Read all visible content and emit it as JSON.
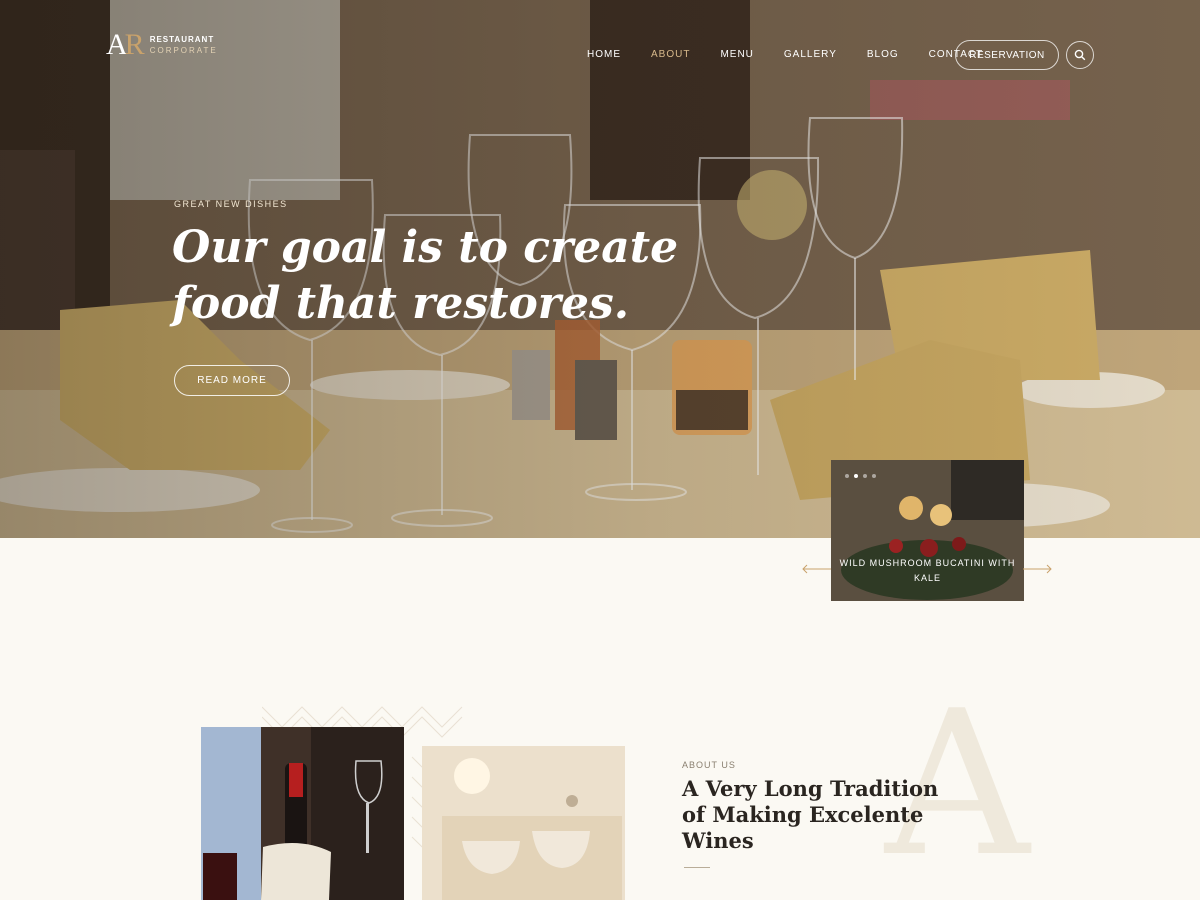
{
  "brand": {
    "mark_a": "A",
    "mark_r": "R",
    "line1": "RESTAURANT",
    "line2": "CORPORATE"
  },
  "nav": {
    "items": [
      {
        "label": "HOME"
      },
      {
        "label": "ABOUT",
        "active": true
      },
      {
        "label": "MENU"
      },
      {
        "label": "GALLERY"
      },
      {
        "label": "BLOG"
      },
      {
        "label": "CONTACT"
      }
    ],
    "reservation_label": "RESERVATION",
    "search_icon": "search-icon"
  },
  "hero": {
    "kicker": "GREAT NEW DISHES",
    "headline": "Our goal is to create food that restores.",
    "cta_label": "READ MORE"
  },
  "slider": {
    "dish_name": "WILD MUSHROOM BUCATINI WITH KALE",
    "dot_count": 4,
    "active_dot": 2,
    "prev_icon": "arrow-left-icon",
    "next_icon": "arrow-right-icon"
  },
  "about": {
    "kicker": "ABOUT US",
    "title": "A Very Long Tradition of Making Excelente Wines",
    "watermark": "A"
  },
  "colors": {
    "accent": "#c9a26b",
    "nav_active": "#d8b98b",
    "background": "#fbf9f3",
    "text_dark": "#2a2520"
  }
}
